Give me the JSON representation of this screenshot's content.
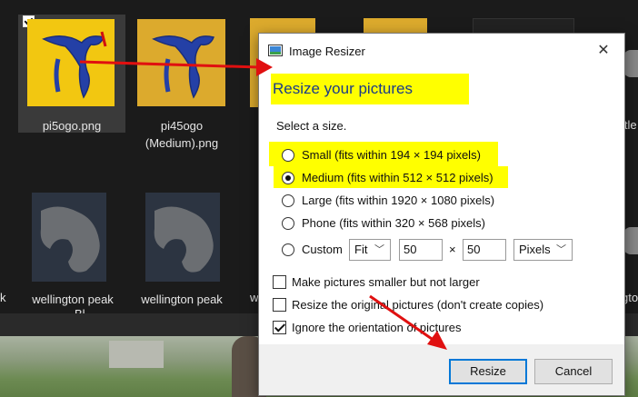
{
  "explorer": {
    "items": [
      {
        "label": "pi5ogo.png",
        "selected": true
      },
      {
        "label": "pi45ogo (Medium).png"
      },
      {
        "label": "wellington peak"
      },
      {
        "label": "wellington peak"
      }
    ],
    "partial_labels": [
      "k",
      "w",
      "itle",
      "gto"
    ],
    "bottom_fragment": "Bl..."
  },
  "dialog": {
    "title": "Image Resizer",
    "heading": "Resize your pictures",
    "instruction": "Select a size.",
    "sizes": [
      {
        "label": "Small (fits within 194 × 194 pixels)",
        "selected": false
      },
      {
        "label": "Medium (fits within 512 × 512 pixels)",
        "selected": true
      },
      {
        "label": "Large (fits within 1920 × 1080 pixels)",
        "selected": false
      },
      {
        "label": "Phone (fits within 320 × 568 pixels)",
        "selected": false
      }
    ],
    "custom": {
      "label": "Custom",
      "fit_mode": "Fit",
      "width": "50",
      "times": "×",
      "height": "50",
      "unit": "Pixels"
    },
    "options": [
      {
        "label": "Make pictures smaller but not larger",
        "checked": false
      },
      {
        "label": "Resize the original pictures (don't create copies)",
        "checked": false
      },
      {
        "label": "Ignore the orientation of pictures",
        "checked": true
      }
    ],
    "resize_button": "Resize",
    "cancel_button": "Cancel",
    "close_glyph": "✕"
  },
  "colors": {
    "highlight": "#ffff00",
    "arrow": "#e01010",
    "heading_text": "#1a3a8a"
  }
}
